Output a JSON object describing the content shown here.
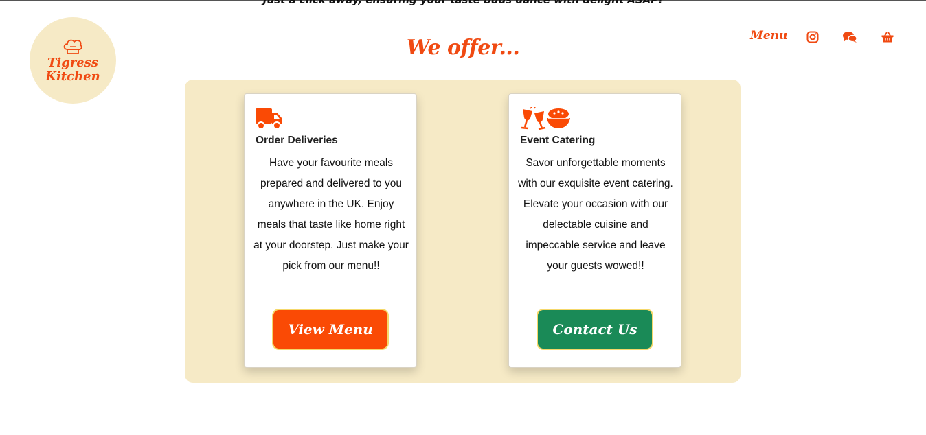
{
  "header": {
    "tagline": "Just a click away, ensuring your taste buds dance with delight ASAP!",
    "logo_line1": "Tigress",
    "logo_line2": "Kitchen",
    "nav": {
      "menu_label": "Menu",
      "icons": [
        "instagram-icon",
        "chat-icon",
        "basket-icon"
      ]
    }
  },
  "section": {
    "heading": "We offer..."
  },
  "cards": [
    {
      "icon": "truck-icon",
      "title": "Order Deliveries",
      "body": "Have your favourite meals prepared and delivered to you anywhere in the UK. Enjoy meals that taste like home right at your doorstep. Just make your pick from our menu!!",
      "button_label": "View Menu"
    },
    {
      "icon": "catering-icon",
      "title": "Event Catering",
      "body": "Savor unforgettable moments with our exquisite event catering. Elevate your occasion with our delectable cuisine and impeccable service and leave your guests wowed!!",
      "button_label": "Contact Us"
    }
  ],
  "colors": {
    "accent": "#f04a12",
    "cream": "#f6eac6",
    "button_orange": "#fa4a05",
    "button_green": "#1a8a57",
    "button_border": "#f5d86b"
  }
}
